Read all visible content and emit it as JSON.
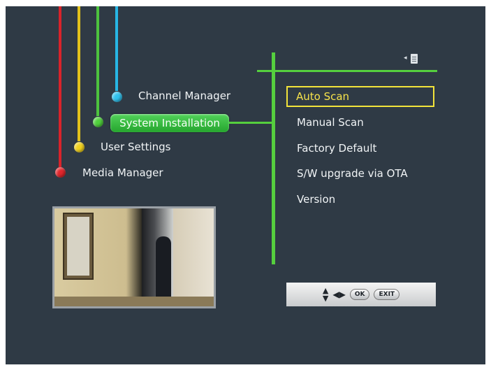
{
  "main_menu": {
    "channel_manager": "Channel Manager",
    "system_installation": "System Installation",
    "user_settings": "User Settings",
    "media_manager": "Media Manager"
  },
  "submenu": {
    "items": [
      {
        "label": "Auto Scan",
        "selected": true
      },
      {
        "label": "Manual Scan",
        "selected": false
      },
      {
        "label": "Factory Default",
        "selected": false
      },
      {
        "label": "S/W upgrade via OTA",
        "selected": false
      },
      {
        "label": "Version",
        "selected": false
      }
    ]
  },
  "help_bar": {
    "ok_label": "OK",
    "exit_label": "EXIT"
  },
  "colors": {
    "background": "#2f3a45",
    "menu_green": "#55cf3e",
    "highlight_yellow": "#f2e33a",
    "line_red": "#d8232a",
    "line_yellow": "#e2c21b",
    "line_green": "#4dc33e",
    "line_cyan": "#27b6e4"
  },
  "icons": {
    "doc": "document-icon",
    "nav_updown": "up-down-arrows-icon",
    "nav_leftright": "left-right-arrows-icon"
  }
}
